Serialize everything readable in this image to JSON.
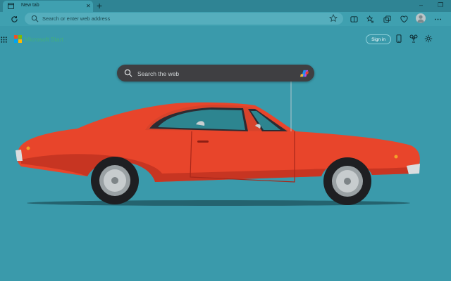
{
  "browser": {
    "tab": {
      "title": "New tab"
    },
    "newtab_label": "+",
    "window_controls": {
      "minimize": "–",
      "restore": "❐"
    },
    "address": {
      "placeholder": "Search or enter web address"
    }
  },
  "newtab_page": {
    "brand": "Microsoft Start",
    "signin_label": "Sign in",
    "search": {
      "placeholder": "Search the web"
    }
  },
  "colors": {
    "background": "#3a9aab",
    "car_body": "#e8452b",
    "search_bg": "#3f3f42"
  }
}
